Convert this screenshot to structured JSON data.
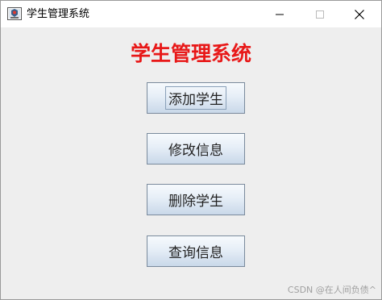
{
  "window": {
    "title": "学生管理系统",
    "controls": {
      "minimize": "minimize-icon",
      "maximize": "maximize-icon",
      "close": "close-icon"
    }
  },
  "main": {
    "heading": "学生管理系统",
    "heading_color": "#e81818",
    "buttons": [
      {
        "label": "添加学生"
      },
      {
        "label": "修改信息"
      },
      {
        "label": "删除学生"
      },
      {
        "label": "查询信息"
      }
    ]
  },
  "watermark": "CSDN @在人间负债^"
}
